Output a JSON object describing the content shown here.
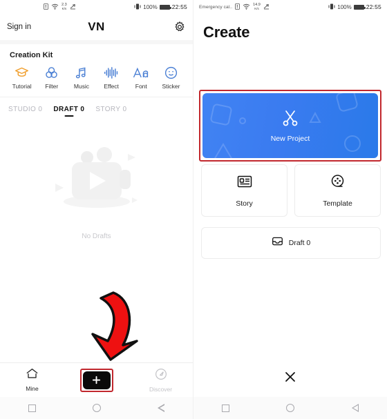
{
  "status_bar": {
    "left": {
      "carrier": "Emergency cal..",
      "net_rate_value": "2.3",
      "net_rate_value_right": "14.9",
      "net_rate_unit": "K/s",
      "sim_icon": "sim-card-icon",
      "wifi_icon": "wifi-icon",
      "upload_icon": "upload-arrow-icon"
    },
    "right": {
      "vibrate_icon": "vibrate-icon",
      "battery_percent": "100%",
      "battery_icon": "battery-full-icon",
      "time": "22:55"
    }
  },
  "left_screen": {
    "appbar": {
      "sign_in": "Sign in",
      "logo": "VN",
      "settings_icon": "gear-icon"
    },
    "creation_kit": {
      "title": "Creation Kit",
      "items": [
        {
          "label": "Tutorial",
          "icon": "graduation-cap-icon",
          "color": "#f0a030"
        },
        {
          "label": "Filter",
          "icon": "color-circles-icon",
          "color": "#4a7fd4"
        },
        {
          "label": "Music",
          "icon": "music-note-icon",
          "color": "#4a7fd4"
        },
        {
          "label": "Effect",
          "icon": "waveform-icon",
          "color": "#4a7fd4"
        },
        {
          "label": "Font",
          "icon": "font-aa-icon",
          "color": "#4a7fd4"
        },
        {
          "label": "Sticker",
          "icon": "smiley-face-icon",
          "color": "#4a7fd4"
        }
      ]
    },
    "tabs": [
      {
        "label": "STUDIO 0",
        "active": false
      },
      {
        "label": "DRAFT 0",
        "active": true
      },
      {
        "label": "STORY 0",
        "active": false
      }
    ],
    "empty_state": {
      "illustration_icon": "video-placeholder-icon",
      "label": "No Drafts"
    },
    "annotation": {
      "arrow_icon": "red-down-arrow-icon",
      "arrow_color": "#ee1111",
      "highlight_color": "#c1272d"
    },
    "tabbar": [
      {
        "label": "Mine",
        "icon": "home-icon",
        "active": true
      },
      {
        "label": "",
        "icon": "plus-icon",
        "active": false
      },
      {
        "label": "Discover",
        "icon": "compass-icon",
        "active": false
      }
    ]
  },
  "right_screen": {
    "title": "Create",
    "new_project": {
      "label": "New Project",
      "icon": "scissors-icon",
      "gradient_from": "#4183f3",
      "gradient_to": "#2a7ae9"
    },
    "cards": [
      {
        "label": "Story",
        "icon": "story-card-icon"
      },
      {
        "label": "Template",
        "icon": "film-reel-icon"
      }
    ],
    "draft": {
      "label": "Draft 0",
      "icon": "inbox-tray-icon"
    },
    "close_icon": "close-x-icon"
  },
  "android_nav": {
    "recents_icon": "square-recents-icon",
    "home_icon": "circle-home-icon",
    "back_icon": "triangle-back-icon"
  }
}
